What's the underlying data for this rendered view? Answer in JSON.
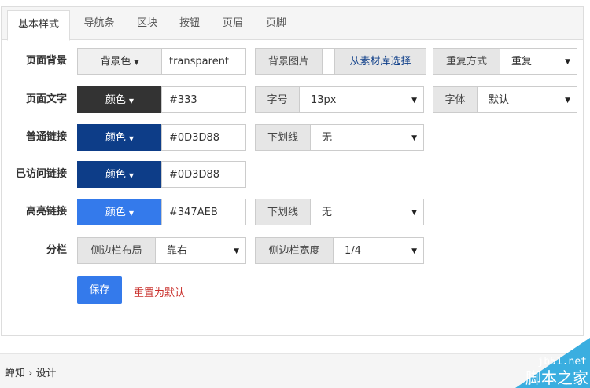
{
  "tabs": [
    "基本样式",
    "导航条",
    "区块",
    "按钮",
    "页眉",
    "页脚"
  ],
  "rows": {
    "bg": {
      "label": "页面背景",
      "button": "背景色",
      "value": "transparent",
      "image_label": "背景图片",
      "image_pick": "从素材库选择",
      "repeat_label": "重复方式",
      "repeat_value": "重复"
    },
    "text": {
      "label": "页面文字",
      "button": "颜色",
      "value": "#333",
      "size_label": "字号",
      "size_value": "13px",
      "font_label": "字体",
      "font_value": "默认"
    },
    "link": {
      "label": "普通链接",
      "button": "颜色",
      "value": "#0D3D88",
      "underline_label": "下划线",
      "underline_value": "无"
    },
    "visited": {
      "label": "已访问链接",
      "button": "颜色",
      "value": "#0D3D88"
    },
    "hover": {
      "label": "高亮链接",
      "button": "颜色",
      "value": "#347AEB",
      "underline_label": "下划线",
      "underline_value": "无"
    },
    "columns": {
      "label": "分栏",
      "layout_label": "侧边栏布局",
      "layout_value": "靠右",
      "width_label": "侧边栏宽度",
      "width_value": "1/4"
    }
  },
  "colors": {
    "text": "#333333",
    "link": "#0D3D88",
    "hover": "#347AEB"
  },
  "actions": {
    "save": "保存",
    "reset": "重置为默认"
  },
  "footer": {
    "breadcrumb": "蝉知 › 设计"
  },
  "watermark": {
    "site": "jb51.net",
    "name": "脚本之家"
  }
}
